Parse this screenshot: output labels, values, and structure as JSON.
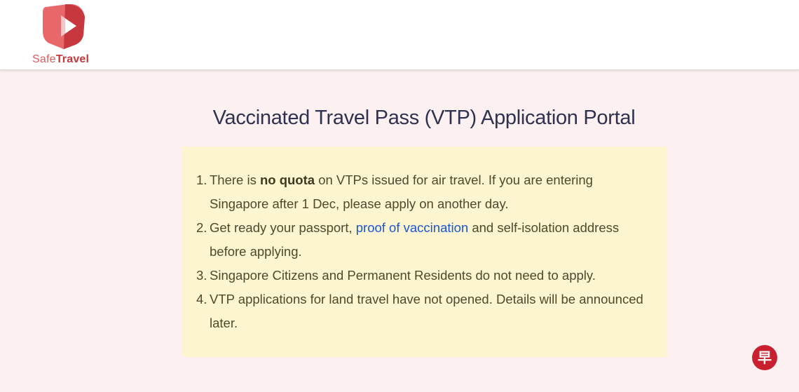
{
  "header": {
    "logo": {
      "icon": "play-shield-icon",
      "brand_part1": "Safe",
      "brand_part2": "Travel",
      "colors": {
        "primary": "#e05a5f",
        "dark": "#c7373e"
      }
    }
  },
  "main": {
    "title": "Vaccinated Travel Pass (VTP) Application Portal",
    "notice": {
      "background": "#fdf5cf",
      "items": [
        {
          "number": "1.",
          "text_before": "There is ",
          "bold": "no quota",
          "text_after": " on VTPs issued for air travel. If you are entering Singapore after 1 Dec, please apply on another day."
        },
        {
          "number": "2.",
          "text_before": "Get ready your passport, ",
          "link": "proof of vaccination",
          "text_after": " and self-isolation address before applying."
        },
        {
          "number": "3.",
          "text": "Singapore Citizens and Permanent Residents do not need to apply."
        },
        {
          "number": "4.",
          "text": "VTP applications for land travel have not opened. Details will be announced later."
        }
      ]
    }
  },
  "watermark": {
    "glyph": "早",
    "icon": "zaobao-badge-icon",
    "color": "#c8202e"
  }
}
